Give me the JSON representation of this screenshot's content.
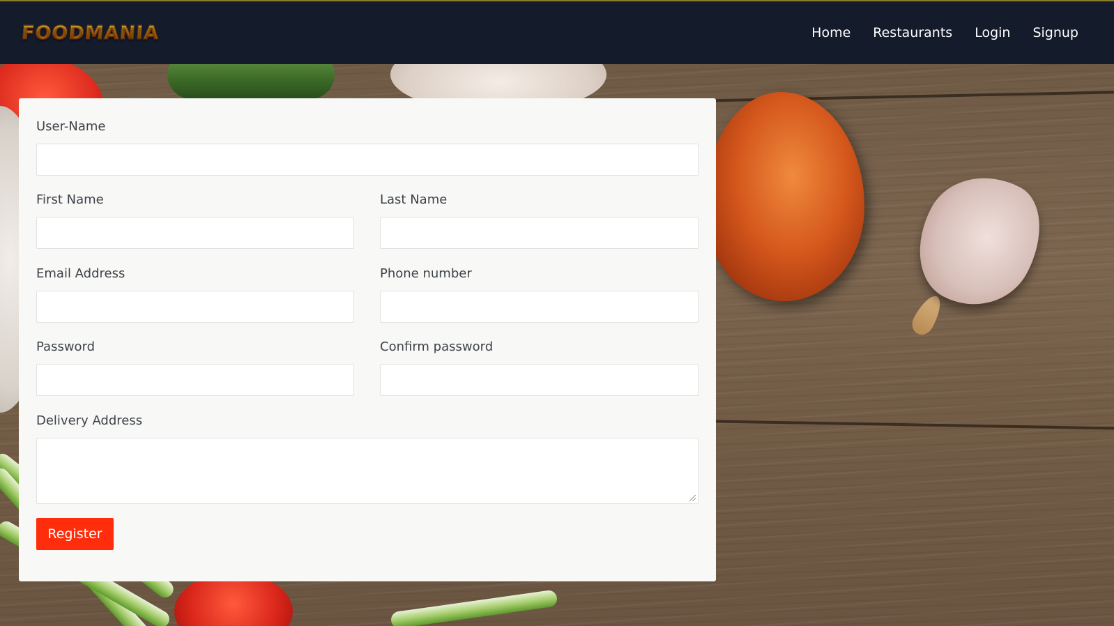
{
  "brand": {
    "logo_text": "FOODMANIA"
  },
  "nav": {
    "items": [
      {
        "label": "Home"
      },
      {
        "label": "Restaurants"
      },
      {
        "label": "Login"
      },
      {
        "label": "Signup"
      }
    ]
  },
  "form": {
    "username": {
      "label": "User-Name",
      "value": ""
    },
    "first_name": {
      "label": "First Name",
      "value": ""
    },
    "last_name": {
      "label": "Last Name",
      "value": ""
    },
    "email": {
      "label": "Email Address",
      "value": ""
    },
    "phone": {
      "label": "Phone number",
      "value": ""
    },
    "password": {
      "label": "Password",
      "value": ""
    },
    "confirm_password": {
      "label": "Confirm password",
      "value": ""
    },
    "delivery_address": {
      "label": "Delivery Address",
      "value": ""
    },
    "submit_label": "Register"
  },
  "colors": {
    "navbar_bg": "#141b2b",
    "accent_button": "#ff2d0b",
    "card_bg": "#f8f8f6",
    "logo_gradient": [
      "#ffd84a",
      "#ff9c12",
      "#e0620a"
    ]
  }
}
